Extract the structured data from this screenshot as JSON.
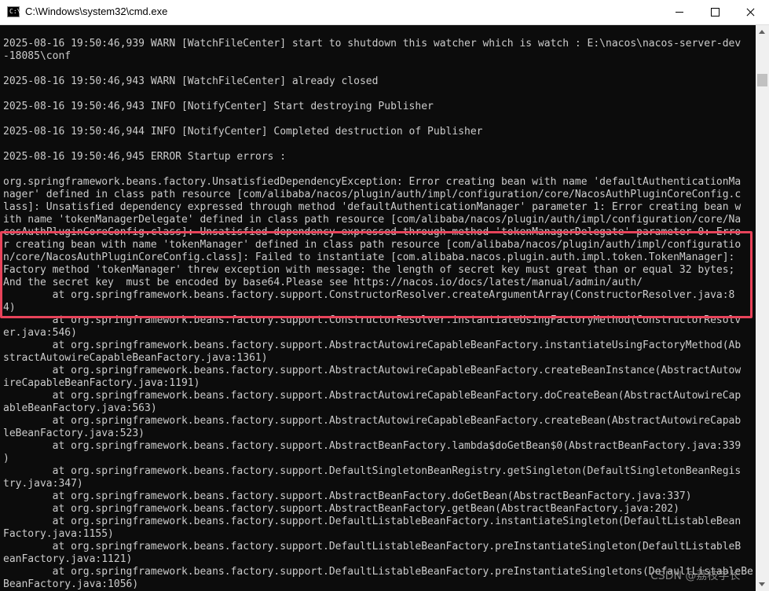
{
  "window": {
    "title": "C:\\Windows\\system32\\cmd.exe",
    "icon": "cmd-icon",
    "icon_glyph": "C:\\",
    "buttons": [
      "minimize",
      "maximize",
      "close"
    ]
  },
  "console": {
    "lines": [
      "2025-08-16 19:50:46,939 WARN [WatchFileCenter] start to shutdown this watcher which is watch : E:\\nacos\\nacos-server-dev",
      "-18085\\conf",
      "2025-08-16 19:50:46,943 WARN [WatchFileCenter] already closed",
      "2025-08-16 19:50:46,943 INFO [NotifyCenter] Start destroying Publisher",
      "2025-08-16 19:50:46,944 INFO [NotifyCenter] Completed destruction of Publisher",
      "2025-08-16 19:50:46,945 ERROR Startup errors :",
      "org.springframework.beans.factory.UnsatisfiedDependencyException: Error creating bean with name 'defaultAuthenticationMa",
      "nager' defined in class path resource [com/alibaba/nacos/plugin/auth/impl/configuration/core/NacosAuthPluginCoreConfig.c",
      "lass]: Unsatisfied dependency expressed through method 'defaultAuthenticationManager' parameter 1: Error creating bean w",
      "ith name 'tokenManagerDelegate' defined in class path resource [com/alibaba/nacos/plugin/auth/impl/configuration/core/Na",
      "cosAuthPluginCoreConfig.class]: Unsatisfied dependency expressed through method 'tokenManagerDelegate' parameter 0: Erro",
      "r creating bean with name 'tokenManager' defined in class path resource [com/alibaba/nacos/plugin/auth/impl/configuratio",
      "n/core/NacosAuthPluginCoreConfig.class]: Failed to instantiate [com.alibaba.nacos.plugin.auth.impl.token.TokenManager]:",
      "Factory method 'tokenManager' threw exception with message: the length of secret key must great than or equal 32 bytes;",
      "And the secret key  must be encoded by base64.Please see https://nacos.io/docs/latest/manual/admin/auth/",
      "        at org.springframework.beans.factory.support.ConstructorResolver.createArgumentArray(ConstructorResolver.java:8",
      "4)",
      "        at org.springframework.beans.factory.support.ConstructorResolver.instantiateUsingFactoryMethod(ConstructorResolv",
      "er.java:546)",
      "        at org.springframework.beans.factory.support.AbstractAutowireCapableBeanFactory.instantiateUsingFactoryMethod(Ab",
      "stractAutowireCapableBeanFactory.java:1361)",
      "        at org.springframework.beans.factory.support.AbstractAutowireCapableBeanFactory.createBeanInstance(AbstractAutow",
      "ireCapableBeanFactory.java:1191)",
      "        at org.springframework.beans.factory.support.AbstractAutowireCapableBeanFactory.doCreateBean(AbstractAutowireCap",
      "ableBeanFactory.java:563)",
      "        at org.springframework.beans.factory.support.AbstractAutowireCapableBeanFactory.createBean(AbstractAutowireCapab",
      "leBeanFactory.java:523)",
      "        at org.springframework.beans.factory.support.AbstractBeanFactory.lambda$doGetBean$0(AbstractBeanFactory.java:339",
      ")",
      "        at org.springframework.beans.factory.support.DefaultSingletonBeanRegistry.getSingleton(DefaultSingletonBeanRegis",
      "try.java:347)",
      "        at org.springframework.beans.factory.support.AbstractBeanFactory.doGetBean(AbstractBeanFactory.java:337)",
      "        at org.springframework.beans.factory.support.AbstractBeanFactory.getBean(AbstractBeanFactory.java:202)",
      "        at org.springframework.beans.factory.support.DefaultListableBeanFactory.instantiateSingleton(DefaultListableBean",
      "Factory.java:1155)",
      "        at org.springframework.beans.factory.support.DefaultListableBeanFactory.preInstantiateSingleton(DefaultListableB",
      "eanFactory.java:1121)",
      "        at org.springframework.beans.factory.support.DefaultListableBeanFactory.preInstantiateSingletons(DefaultListableBe",
      "BeanFactory.java:1056)"
    ]
  },
  "watermark": "CSDN @荔枝学长",
  "colors": {
    "console_bg": "#0c0c0c",
    "console_text": "#cccccc",
    "highlight_border": "#e8435a"
  }
}
